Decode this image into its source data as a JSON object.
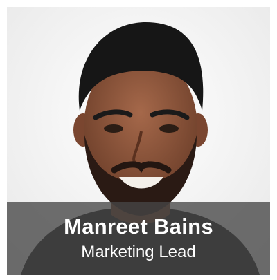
{
  "profile": {
    "name": "Manreet Bains",
    "title": "Marketing Lead"
  },
  "colors": {
    "background": "#f4f4f4",
    "caption_overlay": "#464646",
    "text": "#ffffff"
  }
}
